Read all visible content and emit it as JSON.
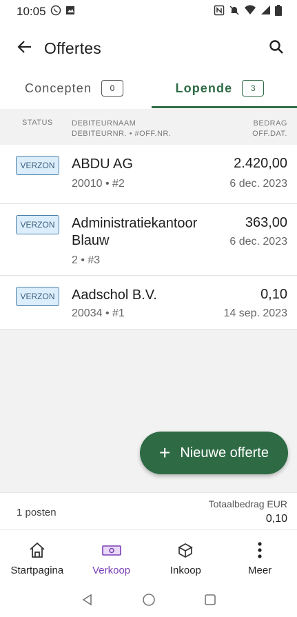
{
  "status_bar": {
    "time": "10:05"
  },
  "header": {
    "title": "Offertes"
  },
  "tabs": [
    {
      "label": "Concepten",
      "count": "0"
    },
    {
      "label": "Lopende",
      "count": "3"
    }
  ],
  "list_header": {
    "status": "STATUS",
    "name_line1": "DEBITEURNAAM",
    "name_line2": "DEBITEURNR. • #OFF.NR.",
    "amount_line1": "BEDRAG",
    "amount_line2": "OFF.DAT."
  },
  "rows": [
    {
      "status": "VERZON",
      "name": "ABDU AG",
      "sub": "20010 • #2",
      "amount": "2.420,00",
      "date": "6 dec. 2023"
    },
    {
      "status": "VERZON",
      "name": "Administratiekantoor Blauw",
      "sub": "2 • #3",
      "amount": "363,00",
      "date": "6 dec. 2023"
    },
    {
      "status": "VERZON",
      "name": "Aadschol B.V.",
      "sub": "20034 • #1",
      "amount": "0,10",
      "date": "14 sep. 2023"
    }
  ],
  "fab": {
    "label": "Nieuwe offerte"
  },
  "totals": {
    "count_label": "1 posten",
    "total_label": "Totaalbedrag EUR",
    "total_value": "0,10"
  },
  "bottom_nav": [
    {
      "label": "Startpagina",
      "icon": "home-icon"
    },
    {
      "label": "Verkoop",
      "icon": "cash-icon"
    },
    {
      "label": "Inkoop",
      "icon": "box-icon"
    },
    {
      "label": "Meer",
      "icon": "more-vertical-icon"
    }
  ],
  "colors": {
    "accent_green": "#2e6b45",
    "nav_active": "#7b3fb5",
    "badge_bg": "#dceefb",
    "badge_border": "#4b7fa8"
  }
}
